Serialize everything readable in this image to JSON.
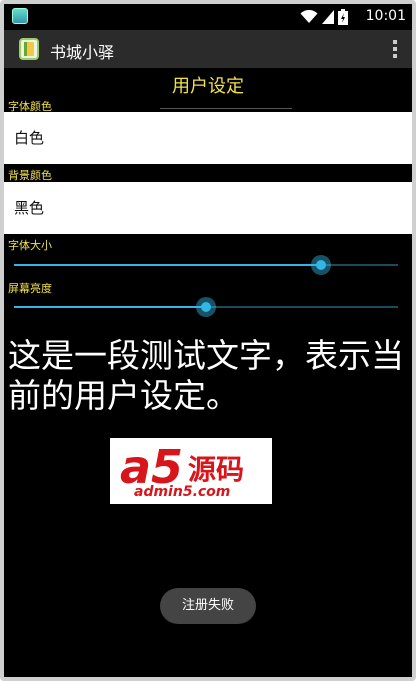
{
  "status_bar": {
    "time": "10:01",
    "icons": [
      "wifi-icon",
      "signal-icon",
      "battery-icon"
    ]
  },
  "action_bar": {
    "title": "书城小驿",
    "overflow_icon": "overflow-menu-icon"
  },
  "page": {
    "title": "用户设定"
  },
  "settings": {
    "font_color": {
      "label": "字体颜色",
      "value": "白色"
    },
    "background_color": {
      "label": "背景颜色",
      "value": "黑色"
    },
    "font_size": {
      "label": "字体大小",
      "level": 0.8
    },
    "brightness": {
      "label": "屏幕亮度",
      "level": 0.5
    }
  },
  "sample_text": "这是一段测试文字，表示当前的用户设定。",
  "logo": {
    "mark": "a5",
    "name": "源码",
    "url": "admin5.com"
  },
  "toast": {
    "text": "注册失败"
  },
  "colors": {
    "accent": "#33b5e5",
    "label": "#f0e24a",
    "logo": "#d8151b"
  }
}
